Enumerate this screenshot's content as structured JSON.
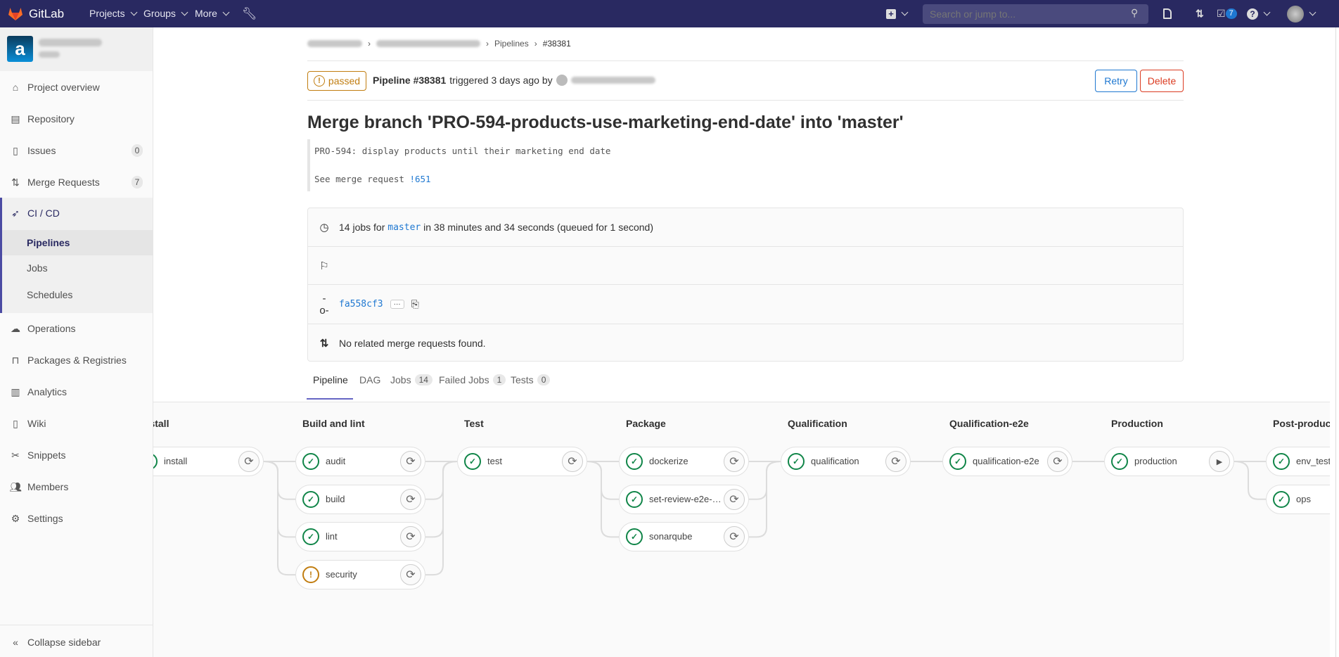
{
  "navbar": {
    "brand": "GitLab",
    "menus": [
      {
        "label": "Projects"
      },
      {
        "label": "Groups"
      },
      {
        "label": "More"
      }
    ],
    "search_placeholder": "Search or jump to...",
    "todos_count": "7",
    "accent": "#292961"
  },
  "sidebar": {
    "items": [
      {
        "label": "Project overview",
        "icon": "home-icon"
      },
      {
        "label": "Repository",
        "icon": "doc-icon"
      },
      {
        "label": "Issues",
        "icon": "issues-icon",
        "count": "0"
      },
      {
        "label": "Merge Requests",
        "icon": "merge-request-icon",
        "count": "7"
      },
      {
        "label": "CI / CD",
        "icon": "rocket-icon"
      },
      {
        "label": "Operations",
        "icon": "cloud-gear-icon"
      },
      {
        "label": "Packages & Registries",
        "icon": "package-icon"
      },
      {
        "label": "Analytics",
        "icon": "chart-icon"
      },
      {
        "label": "Wiki",
        "icon": "book-icon"
      },
      {
        "label": "Snippets",
        "icon": "scissors-icon"
      },
      {
        "label": "Members",
        "icon": "users-icon"
      },
      {
        "label": "Settings",
        "icon": "gear-icon"
      }
    ],
    "cicd_sub": [
      {
        "label": "Pipelines",
        "active": true
      },
      {
        "label": "Jobs"
      },
      {
        "label": "Schedules"
      }
    ],
    "collapse_label": "Collapse sidebar"
  },
  "breadcrumb": {
    "pipelines": "Pipelines",
    "current": "#38381"
  },
  "header": {
    "status": "passed",
    "pipeline_label": "Pipeline #38381",
    "triggered": "triggered 3 days ago by",
    "retry_label": "Retry",
    "delete_label": "Delete"
  },
  "commit": {
    "title": "Merge branch 'PRO-594-products-use-marketing-end-date' into 'master'",
    "body_line1": "PRO-594: display products until their marketing end date",
    "body_line2_prefix": "See merge request ",
    "body_line2_link": "!651"
  },
  "info": {
    "jobs_prefix": "14 jobs for",
    "branch": "master",
    "jobs_suffix": "in 38 minutes and 34 seconds (queued for 1 second)",
    "sha": "fa558cf3",
    "ellipsis": "···",
    "mr_text": "No related merge requests found."
  },
  "tabs": [
    {
      "label": "Pipeline",
      "active": true
    },
    {
      "label": "DAG"
    },
    {
      "label": "Jobs",
      "count": "14"
    },
    {
      "label": "Failed Jobs",
      "count": "1"
    },
    {
      "label": "Tests",
      "count": "0"
    }
  ],
  "stages": [
    {
      "title": "Install",
      "jobs": [
        {
          "name": "install",
          "status": "success",
          "action": "retry"
        }
      ]
    },
    {
      "title": "Build and lint",
      "jobs": [
        {
          "name": "audit",
          "status": "success",
          "action": "retry"
        },
        {
          "name": "build",
          "status": "success",
          "action": "retry"
        },
        {
          "name": "lint",
          "status": "success",
          "action": "retry"
        },
        {
          "name": "security",
          "status": "warning",
          "action": "retry"
        }
      ]
    },
    {
      "title": "Test",
      "jobs": [
        {
          "name": "test",
          "status": "success",
          "action": "retry"
        }
      ]
    },
    {
      "title": "Package",
      "jobs": [
        {
          "name": "dockerize",
          "status": "success",
          "action": "retry"
        },
        {
          "name": "set-review-e2e-e...",
          "status": "success",
          "action": "retry"
        },
        {
          "name": "sonarqube",
          "status": "success",
          "action": "retry"
        }
      ]
    },
    {
      "title": "Qualification",
      "jobs": [
        {
          "name": "qualification",
          "status": "success",
          "action": "retry"
        }
      ]
    },
    {
      "title": "Qualification-e2e",
      "jobs": [
        {
          "name": "qualification-e2e",
          "status": "success",
          "action": "retry"
        }
      ]
    },
    {
      "title": "Production",
      "jobs": [
        {
          "name": "production",
          "status": "success",
          "action": "play"
        }
      ]
    },
    {
      "title": "Post-production",
      "jobs": [
        {
          "name": "env_test",
          "status": "success",
          "action": null
        },
        {
          "name": "ops",
          "status": "success",
          "action": null
        }
      ]
    }
  ],
  "colors": {
    "success": "#108548",
    "warning": "#c17d10",
    "link": "#1f78d1",
    "danger": "#db3b21"
  }
}
